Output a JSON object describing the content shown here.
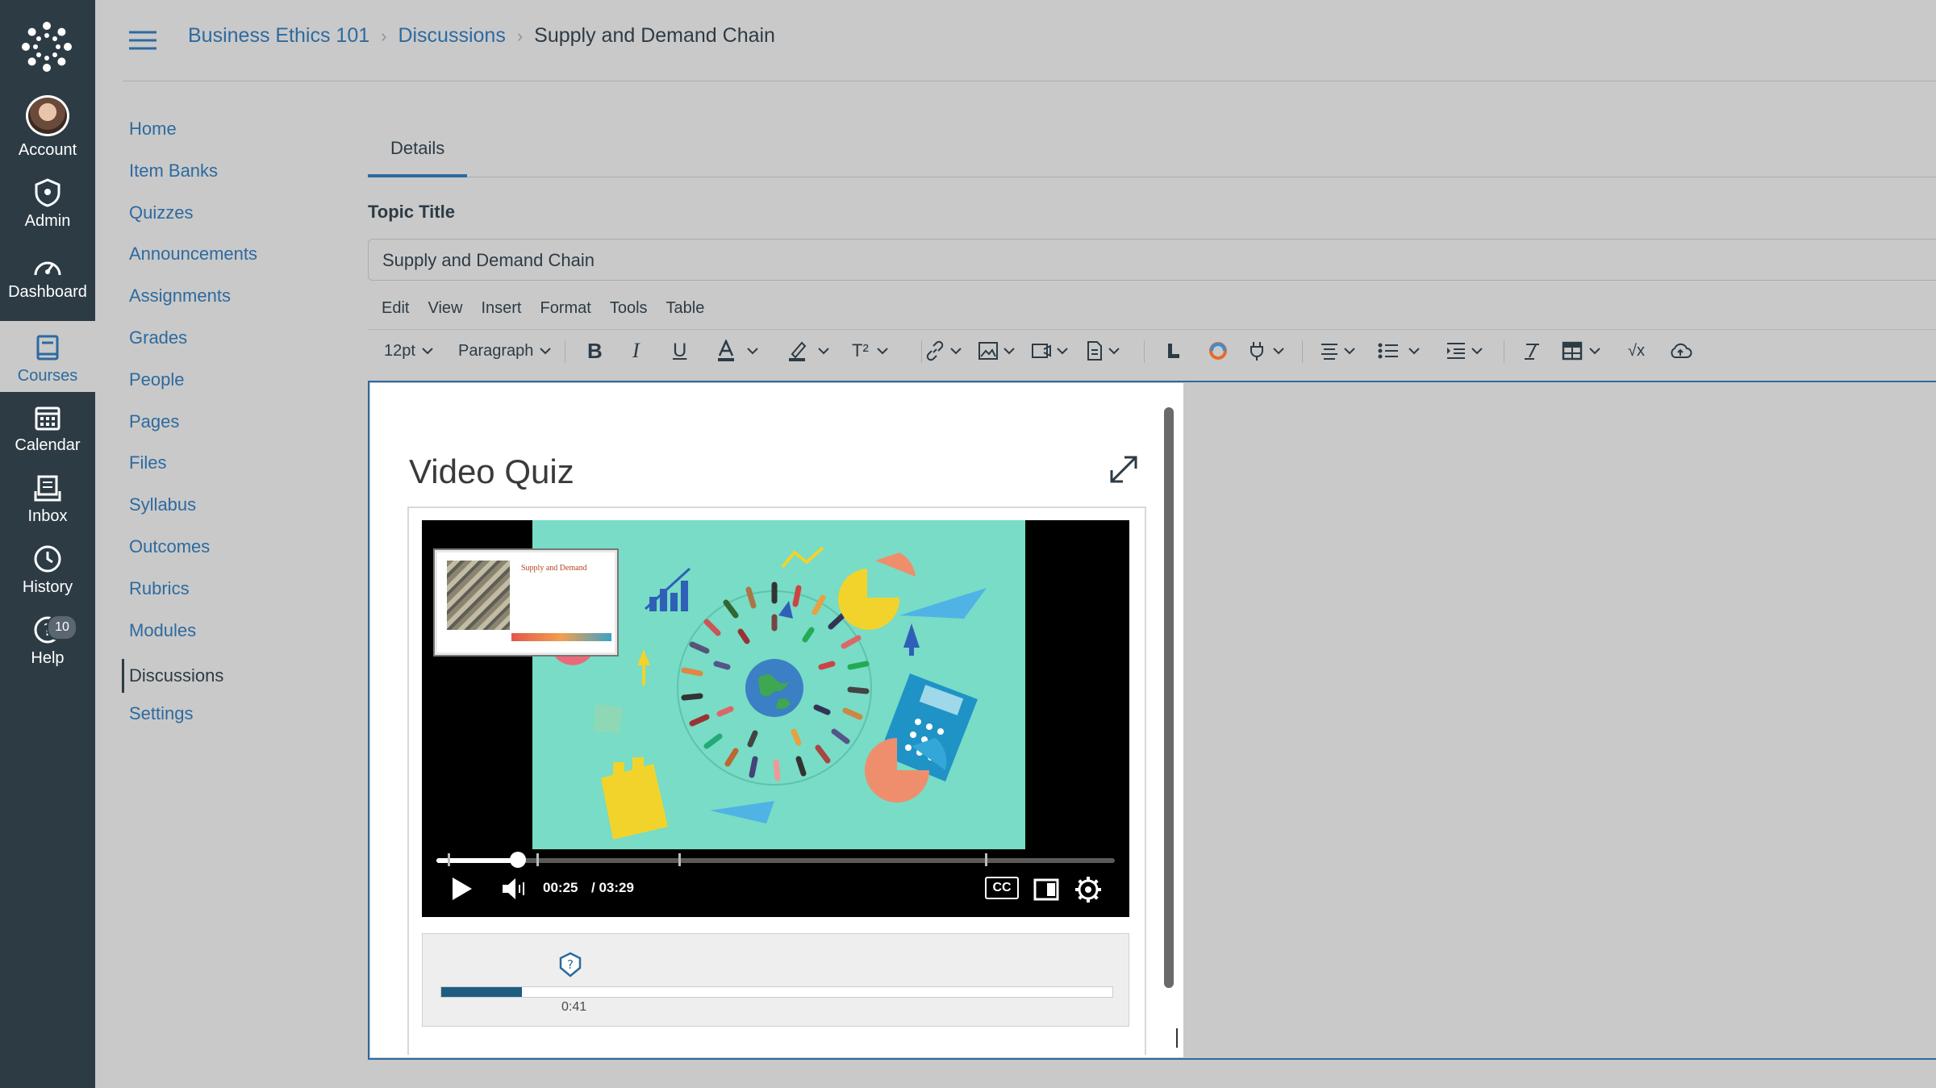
{
  "global_nav": {
    "items": [
      {
        "label": "Account",
        "icon": "avatar"
      },
      {
        "label": "Admin",
        "icon": "shield-icon"
      },
      {
        "label": "Dashboard",
        "icon": "dashboard-icon"
      },
      {
        "label": "Courses",
        "icon": "courses-icon"
      },
      {
        "label": "Calendar",
        "icon": "calendar-icon"
      },
      {
        "label": "Inbox",
        "icon": "inbox-icon"
      },
      {
        "label": "History",
        "icon": "clock-icon"
      },
      {
        "label": "Help",
        "icon": "help-icon",
        "badge": "10"
      }
    ],
    "active": "Courses"
  },
  "breadcrumb": {
    "course": "Business Ethics 101",
    "section": "Discussions",
    "current": "Supply and Demand Chain"
  },
  "course_nav": {
    "items": [
      "Home",
      "Item Banks",
      "Quizzes",
      "Announcements",
      "Assignments",
      "Grades",
      "People",
      "Pages",
      "Files",
      "Syllabus",
      "Outcomes",
      "Rubrics",
      "Modules",
      "Discussions",
      "Settings"
    ],
    "active": "Discussions"
  },
  "tabs": {
    "details": "Details"
  },
  "form": {
    "topic_title_label": "Topic Title",
    "topic_title_value": "Supply and Demand Chain"
  },
  "editor_menu": [
    "Edit",
    "View",
    "Insert",
    "Format",
    "Tools",
    "Table"
  ],
  "toolbar": {
    "font_size": "12pt",
    "block_format": "Paragraph",
    "superscript": "T²"
  },
  "content": {
    "heading": "Video Quiz",
    "video": {
      "thumbnail_title": "Supply and Demand",
      "current_time": "00:25",
      "duration": "/ 03:29",
      "progress": 0.12,
      "cc_label": "CC"
    },
    "quiz_timeline": {
      "marker_time": "0:41",
      "progress": 0.12
    }
  },
  "colors": {
    "nav_bg": "#2d3b45",
    "link": "#2d6a9f",
    "quiz_fill": "#1f5c80",
    "video_scene": "#78dcc6"
  }
}
